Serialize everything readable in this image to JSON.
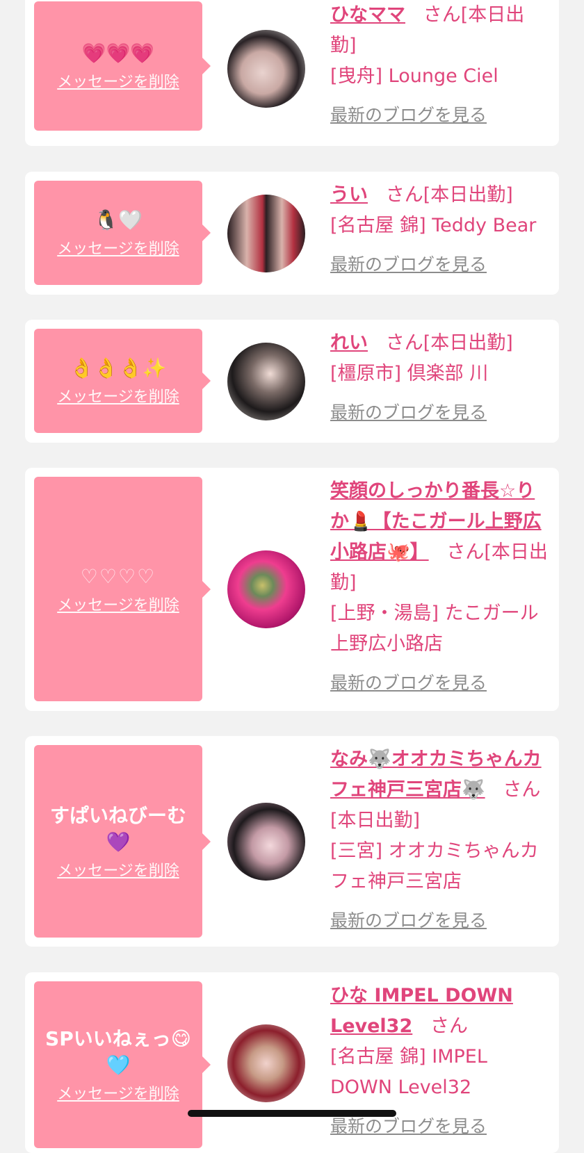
{
  "delete_label": "メッセージを削除",
  "blog_label": "最新のブログを見る",
  "san_label": "さん",
  "cards": [
    {
      "message": "💗💗💗",
      "name": "ひなママ",
      "status": "[本日出勤]",
      "area": "[曳舟] Lounge Ciel"
    },
    {
      "message": "🐧🤍",
      "name": "うい",
      "status": "[本日出勤]",
      "area": "[名古屋 錦] Teddy Bear"
    },
    {
      "message": "👌👌👌✨",
      "name": "れい",
      "status": "[本日出勤]",
      "area": "[橿原市] 倶楽部 川"
    },
    {
      "message": "♡♡♡♡",
      "name": "笑顔のしっかり番長☆りか💄【たこガール上野広小路店🐙】",
      "status": "[本日出勤]",
      "area": "[上野・湯島] たこガール上野広小路店"
    },
    {
      "message": "すぱいねびーむ💜",
      "name": "なみ🐺オオカミちゃんカフェ神戸三宮店🐺",
      "status": "[本日出勤]",
      "area": "[三宮] オオカミちゃんカフェ神戸三宮店"
    },
    {
      "message": "SPいいねぇっ😋🩵",
      "name": "ひな IMPEL DOWN Level32",
      "status": "",
      "area": "[名古屋 錦] IMPEL DOWN Level32"
    }
  ]
}
